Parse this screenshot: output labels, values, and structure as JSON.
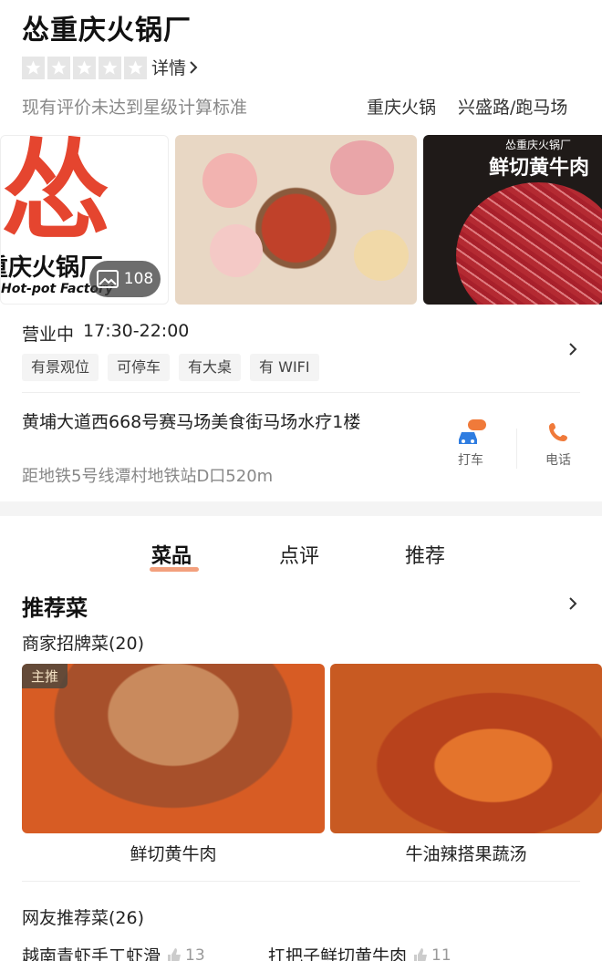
{
  "shop": {
    "name": "怂重庆火锅厂",
    "details_label": "详情",
    "rating_note": "现有评价未达到星级计算标准",
    "cuisine": "重庆火锅",
    "region": "兴盛路/跑马场"
  },
  "gallery": {
    "logo_char": "怂",
    "logo_sub": "重庆火锅厂",
    "logo_en": "Hot-pot Factory",
    "photo_count": "108",
    "image3_brand": "怂重庆火锅厂",
    "image3_title": "鲜切黄牛肉"
  },
  "info": {
    "status": "营业中",
    "hours": "17:30-22:00",
    "tags": [
      "有景观位",
      "可停车",
      "有大桌",
      "有 WIFI"
    ],
    "address": "黄埔大道西668号赛马场美食街马场水疗1楼",
    "metro": "距地铁5号线潭村地铁站D口520m",
    "taxi_badge": "打车",
    "taxi_label": "打车",
    "phone_label": "电话"
  },
  "tabs": [
    {
      "label": "菜品",
      "active": true
    },
    {
      "label": "点评",
      "active": false
    },
    {
      "label": "推荐",
      "active": false
    }
  ],
  "dishes": {
    "section_title": "推荐菜",
    "signature_title": "商家招牌菜(20)",
    "main_badge": "主推",
    "items": [
      {
        "name": "鲜切黄牛肉"
      },
      {
        "name": "牛油辣搭果蔬汤"
      }
    ],
    "user_title": "网友推荐菜(26)",
    "user_items": [
      {
        "name": "越南青虾手工虾滑",
        "likes": "13"
      },
      {
        "name": "扛把子鲜切黄牛肉",
        "likes": "11"
      }
    ]
  },
  "colors": {
    "accent_orange": "#f3a07d",
    "logo_red": "#e5452f",
    "taxi_blue": "#2f7de1",
    "phone_orange": "#f07a3a"
  }
}
